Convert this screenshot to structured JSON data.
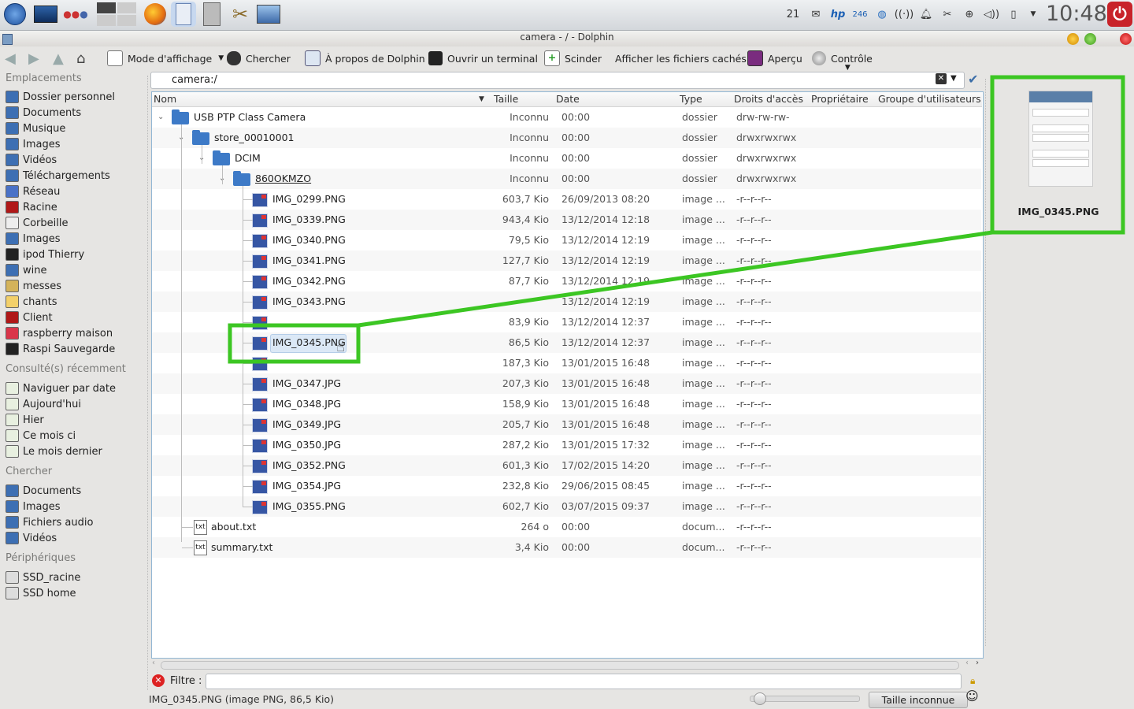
{
  "panel": {
    "icons": [
      "kde-menu-icon",
      "desktop-icon",
      "activities-icon",
      "pager-icon",
      "firefox-icon",
      "dolphin-icon",
      "calculator-icon",
      "settings-icon",
      "photo-icon"
    ],
    "tray_number": "21",
    "tray_num2": "246",
    "clock": "10:48"
  },
  "window": {
    "title": "camera - / - Dolphin"
  },
  "toolbar": {
    "view_mode": "Mode d'affichage",
    "search": "Chercher",
    "about": "À propos de Dolphin",
    "terminal": "Ouvrir un terminal",
    "split": "Scinder",
    "hidden": "Afficher les fichiers cachés",
    "preview": "Aperçu",
    "control": "Contrôle"
  },
  "places": {
    "title": "Emplacements",
    "items": [
      "Dossier personnel",
      "Documents",
      "Musique",
      "Images",
      "Vidéos",
      "Téléchargements",
      "Réseau",
      "Racine",
      "Corbeille",
      "Images",
      "ipod Thierry",
      "wine",
      "messes",
      "chants",
      "Client",
      "raspberry maison",
      "Raspi Sauvegarde"
    ],
    "recent_title": "Consulté(s) récemment",
    "recent": [
      "Naviguer par date",
      "Aujourd'hui",
      "Hier",
      "Ce mois ci",
      "Le mois dernier"
    ],
    "search_title": "Chercher",
    "search": [
      "Documents",
      "Images",
      "Fichiers audio",
      "Vidéos"
    ],
    "devices_title": "Périphériques",
    "devices": [
      "SSD_racine",
      "SSD home"
    ]
  },
  "location": {
    "path": "camera:/"
  },
  "columns": [
    "Nom",
    "Taille",
    "Date",
    "Type",
    "Droits d'accès",
    "Propriétaire",
    "Groupe d'utilisateurs"
  ],
  "rows": [
    {
      "name": "USB PTP Class Camera",
      "size": "Inconnu",
      "date": "00:00",
      "type": "dossier",
      "perm": "drw-rw-rw-"
    },
    {
      "name": "store_00010001",
      "size": "Inconnu",
      "date": "00:00",
      "type": "dossier",
      "perm": "drwxrwxrwx"
    },
    {
      "name": "DCIM",
      "size": "Inconnu",
      "date": "00:00",
      "type": "dossier",
      "perm": "drwxrwxrwx"
    },
    {
      "name": "860OKMZO",
      "size": "Inconnu",
      "date": "00:00",
      "type": "dossier",
      "perm": "drwxrwxrwx"
    },
    {
      "name": "IMG_0299.PNG",
      "size": "603,7 Kio",
      "date": "26/09/2013 08:20",
      "type": "image ...",
      "perm": "-r--r--r--"
    },
    {
      "name": "IMG_0339.PNG",
      "size": "943,4 Kio",
      "date": "13/12/2014 12:18",
      "type": "image ...",
      "perm": "-r--r--r--"
    },
    {
      "name": "IMG_0340.PNG",
      "size": "79,5 Kio",
      "date": "13/12/2014 12:19",
      "type": "image ...",
      "perm": "-r--r--r--"
    },
    {
      "name": "IMG_0341.PNG",
      "size": "127,7 Kio",
      "date": "13/12/2014 12:19",
      "type": "image ...",
      "perm": "-r--r--r--"
    },
    {
      "name": "IMG_0342.PNG",
      "size": "87,7 Kio",
      "date": "13/12/2014 12:19",
      "type": "image ...",
      "perm": "-r--r--r--"
    },
    {
      "name": "IMG_0343.PNG",
      "size": "",
      "date": "13/12/2014 12:19",
      "type": "image ...",
      "perm": "-r--r--r--"
    },
    {
      "name": "",
      "size": "83,9 Kio",
      "date": "13/12/2014 12:37",
      "type": "image ...",
      "perm": "-r--r--r--"
    },
    {
      "name": "IMG_0345.PNG",
      "size": "86,5 Kio",
      "date": "13/12/2014 12:37",
      "type": "image ...",
      "perm": "-r--r--r--"
    },
    {
      "name": "",
      "size": "187,3 Kio",
      "date": "13/01/2015 16:48",
      "type": "image ...",
      "perm": "-r--r--r--"
    },
    {
      "name": "IMG_0347.JPG",
      "size": "207,3 Kio",
      "date": "13/01/2015 16:48",
      "type": "image ...",
      "perm": "-r--r--r--"
    },
    {
      "name": "IMG_0348.JPG",
      "size": "158,9 Kio",
      "date": "13/01/2015 16:48",
      "type": "image ...",
      "perm": "-r--r--r--"
    },
    {
      "name": "IMG_0349.JPG",
      "size": "205,7 Kio",
      "date": "13/01/2015 16:48",
      "type": "image ...",
      "perm": "-r--r--r--"
    },
    {
      "name": "IMG_0350.JPG",
      "size": "287,2 Kio",
      "date": "13/01/2015 17:32",
      "type": "image ...",
      "perm": "-r--r--r--"
    },
    {
      "name": "IMG_0352.PNG",
      "size": "601,3 Kio",
      "date": "17/02/2015 14:20",
      "type": "image ...",
      "perm": "-r--r--r--"
    },
    {
      "name": "IMG_0354.JPG",
      "size": "232,8 Kio",
      "date": "29/06/2015 08:45",
      "type": "image ...",
      "perm": "-r--r--r--"
    },
    {
      "name": "IMG_0355.PNG",
      "size": "602,7 Kio",
      "date": "03/07/2015 09:37",
      "type": "image ...",
      "perm": "-r--r--r--"
    },
    {
      "name": "about.txt",
      "size": "264 o",
      "date": "00:00",
      "type": "docum...",
      "perm": "-r--r--r--"
    },
    {
      "name": "summary.txt",
      "size": "3,4 Kio",
      "date": "00:00",
      "type": "docum...",
      "perm": "-r--r--r--"
    }
  ],
  "preview": {
    "filename": "IMG_0345.PNG"
  },
  "filter": {
    "label": "Filtre :",
    "value": ""
  },
  "status": {
    "text": "IMG_0345.PNG (image PNG, 86,5 Kio)",
    "size_button": "Taille inconnue"
  },
  "colors": {
    "highlight": "#3cc623",
    "selection": "#dbe8f6",
    "accent": "#3d7ac7"
  }
}
